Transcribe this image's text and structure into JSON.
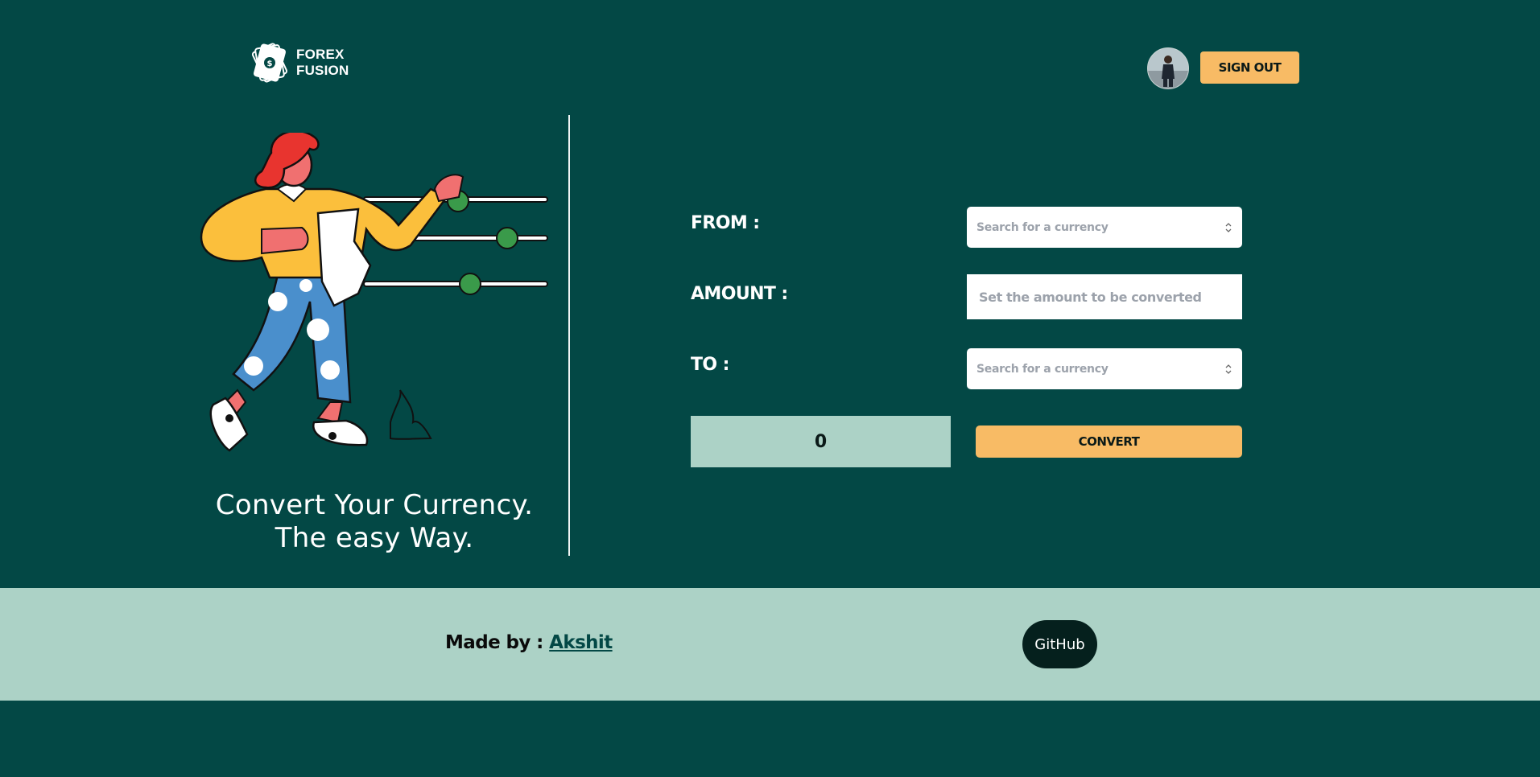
{
  "header": {
    "logo": {
      "line1": "FOREX",
      "line2": "FUSION"
    },
    "avatar_icon": "user-avatar",
    "signout_label": "SIGN OUT"
  },
  "hero": {
    "tagline_line1": "Convert Your Currency.",
    "tagline_line2": "The easy Way."
  },
  "converter": {
    "from_label": "FROM :",
    "from_placeholder": "Search for a currency",
    "amount_label": "AMOUNT :",
    "amount_placeholder": "Set the amount to be converted",
    "to_label": "TO :",
    "to_placeholder": "Search for a currency",
    "result": "0",
    "convert_label": "CONVERT"
  },
  "footer": {
    "made_by": "Made by :",
    "author": "Akshit",
    "github_label": "GitHub"
  },
  "colors": {
    "background": "#034845",
    "accent": "#f8bb65",
    "footer": "#acd2c6"
  }
}
